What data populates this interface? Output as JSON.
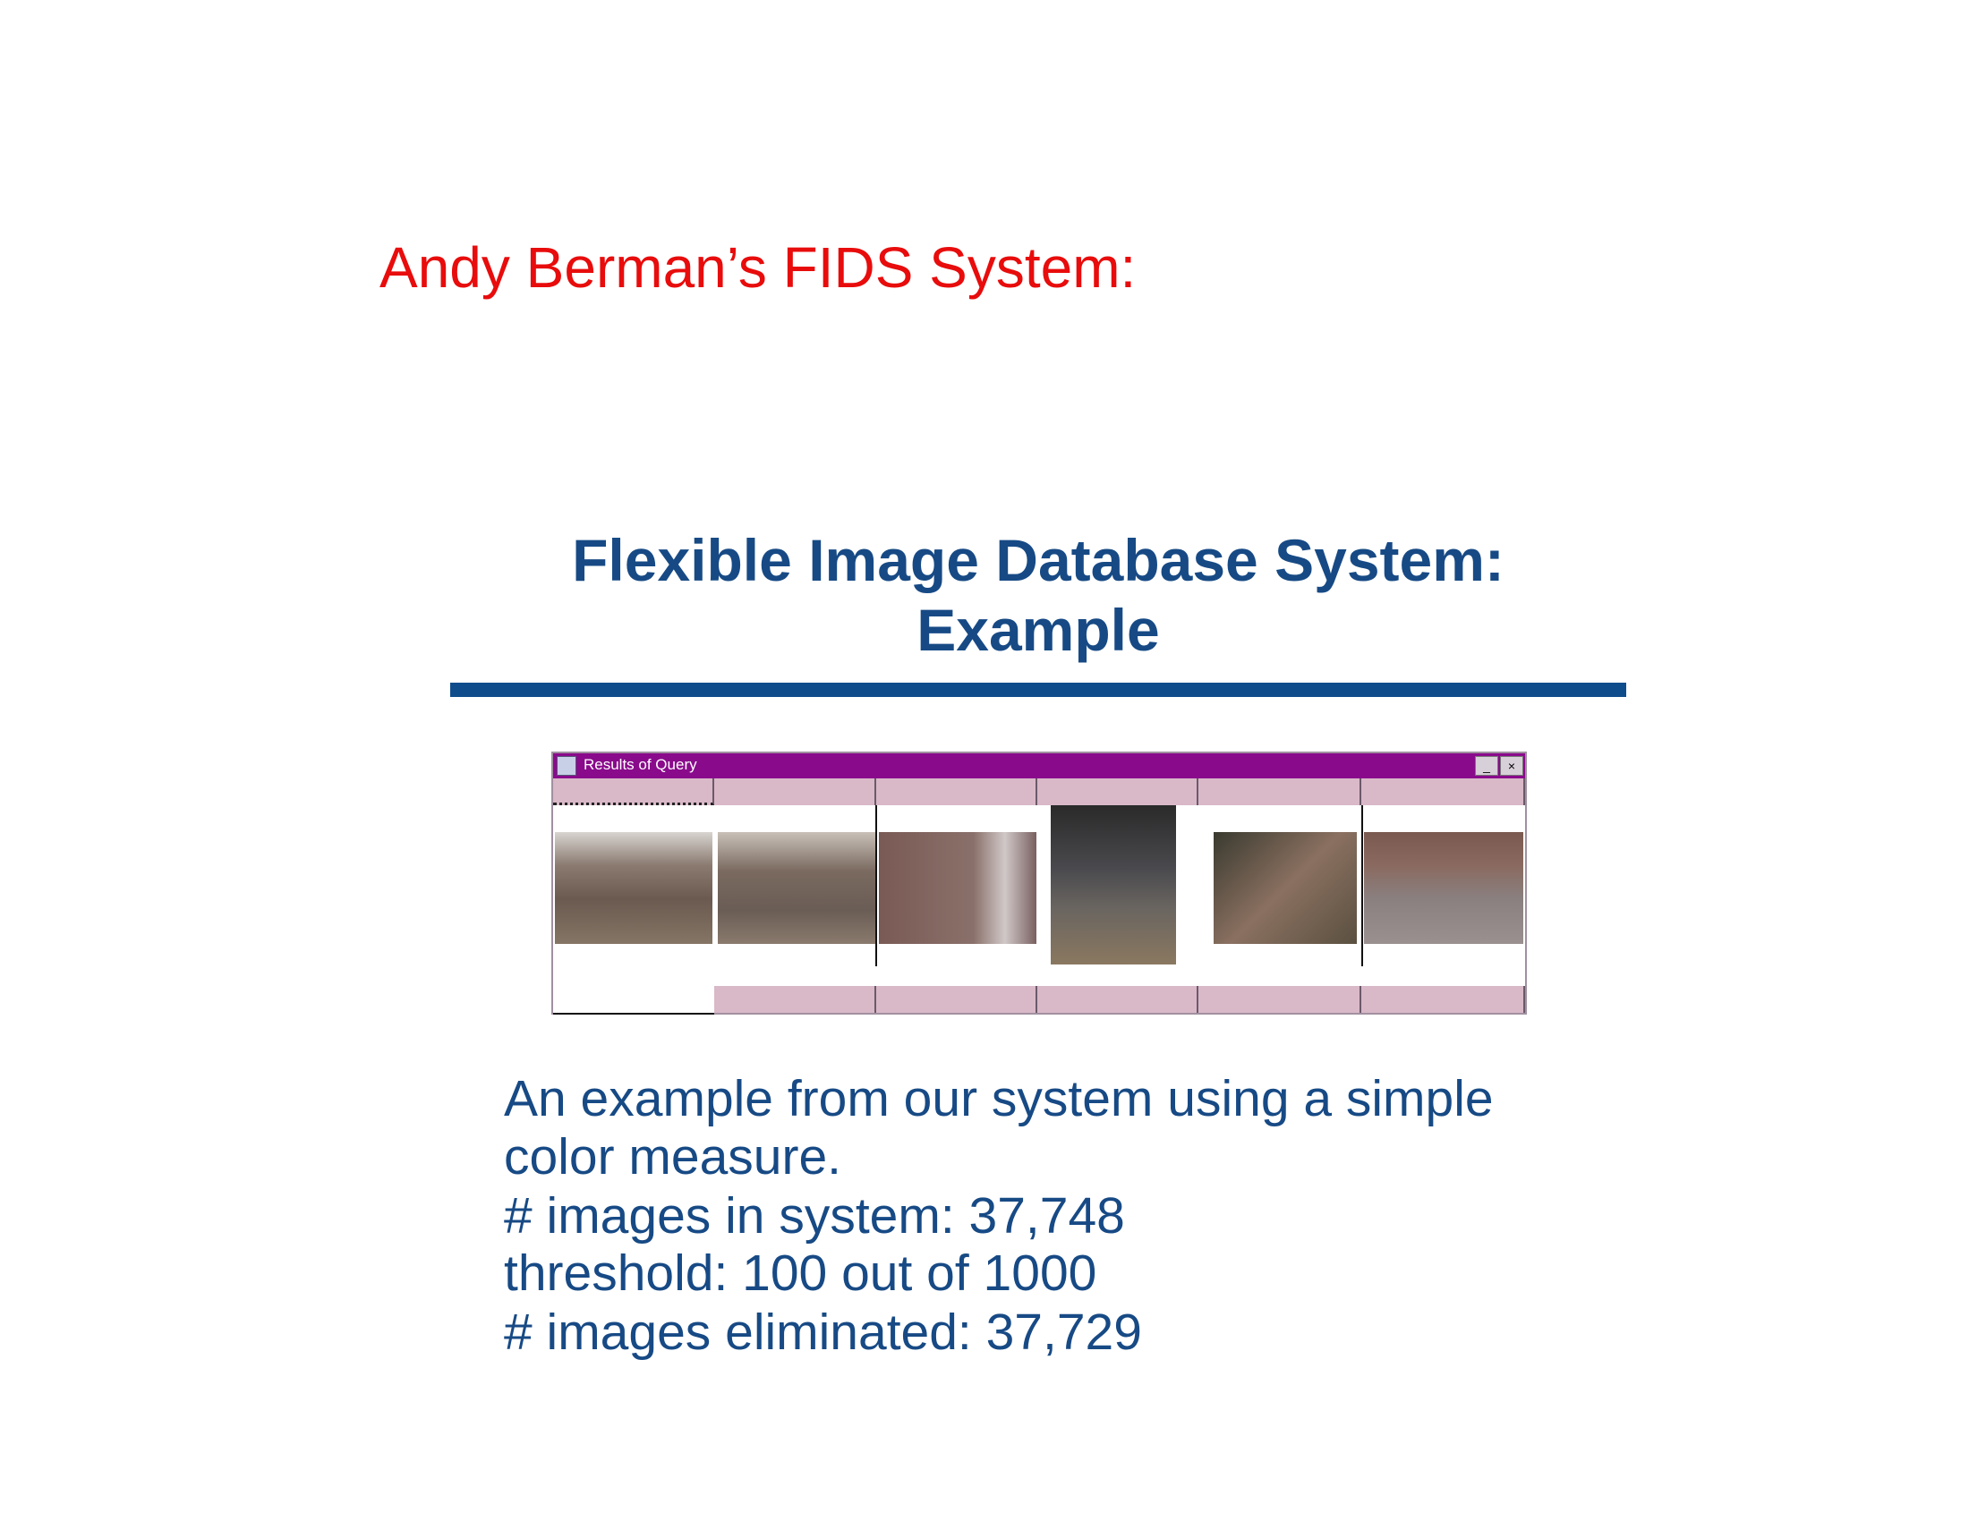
{
  "slide_title": "Andy Berman’s FIDS System:",
  "heading": {
    "line1": "Flexible Image Database System:",
    "line2": "Example"
  },
  "window": {
    "title": "Results of Query",
    "minimize_label": "_",
    "close_label": "×"
  },
  "body": [
    "An example from our system using a simple",
    "color measure.",
    "# images in system: 37,748",
    "threshold: 100 out of 1000",
    "# images eliminated: 37,729"
  ],
  "colors": {
    "title": "#e80c0c",
    "heading": "#174a85",
    "titlebar": "#8a0a8c"
  }
}
